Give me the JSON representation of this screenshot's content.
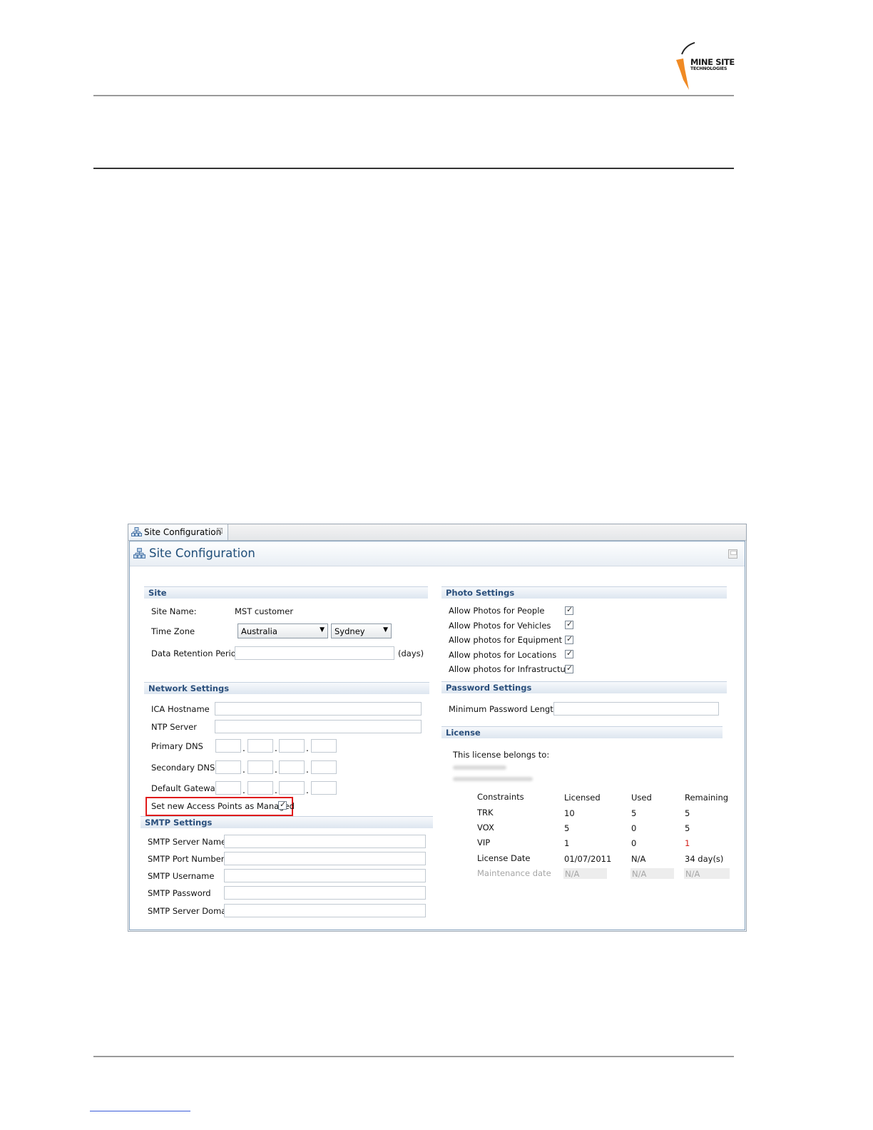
{
  "logo": {
    "line1": "MINE SITE",
    "line2": "TECHNOLOGIES"
  },
  "window": {
    "tab_label": "Site Configuration",
    "title": "Site Configuration"
  },
  "site": {
    "header": "Site",
    "site_name_label": "Site Name:",
    "site_name_value": "MST  customer",
    "time_zone_label": "Time Zone",
    "time_zone_region": "Australia",
    "time_zone_city": "Sydney",
    "retention_label": "Data Retention Period",
    "retention_unit": "(days)"
  },
  "network": {
    "header": "Network Settings",
    "ica_label": "ICA Hostname",
    "ntp_label": "NTP Server",
    "primary_dns_label": "Primary DNS",
    "secondary_dns_label": "Secondary DNS",
    "gateway_label": "Default Gateway",
    "managed_label": "Set new Access Points as Managed",
    "managed_checked": true
  },
  "smtp": {
    "header": "SMTP Settings",
    "server_name_label": "SMTP Server Name",
    "port_label": "SMTP Port Number",
    "username_label": "SMTP Username",
    "password_label": "SMTP Password",
    "domain_label": "SMTP Server Domain"
  },
  "photo": {
    "header": "Photo Settings",
    "items": [
      {
        "label": "Allow Photos for People",
        "checked": true
      },
      {
        "label": "Allow Photos for Vehicles",
        "checked": true
      },
      {
        "label": "Allow photos for Equipment",
        "checked": true
      },
      {
        "label": "Allow photos for Locations",
        "checked": true
      },
      {
        "label": "Allow photos for Infrastructure",
        "checked": true
      }
    ]
  },
  "password": {
    "header": "Password Settings",
    "min_length_label": "Minimum Password Length"
  },
  "license": {
    "header": "License",
    "belongs_label": "This license belongs to:",
    "columns": [
      "Constraints",
      "Licensed",
      "Used",
      "Remaining"
    ],
    "rows": [
      [
        "TRK",
        "10",
        "5",
        "5"
      ],
      [
        "VOX",
        "5",
        "0",
        "5"
      ],
      [
        "VIP",
        "1",
        "0",
        "1"
      ],
      [
        "License Date",
        "01/07/2011",
        "N/A",
        "34 day(s)"
      ],
      [
        "Maintenance date",
        "N/A",
        "N/A",
        "N/A"
      ]
    ]
  },
  "colors": {
    "accent": "#1f4e79",
    "section_text": "#2a4f7c",
    "highlight": "#e01b1b",
    "warning": "#d4201a",
    "logo_orange": "#f08a24"
  }
}
